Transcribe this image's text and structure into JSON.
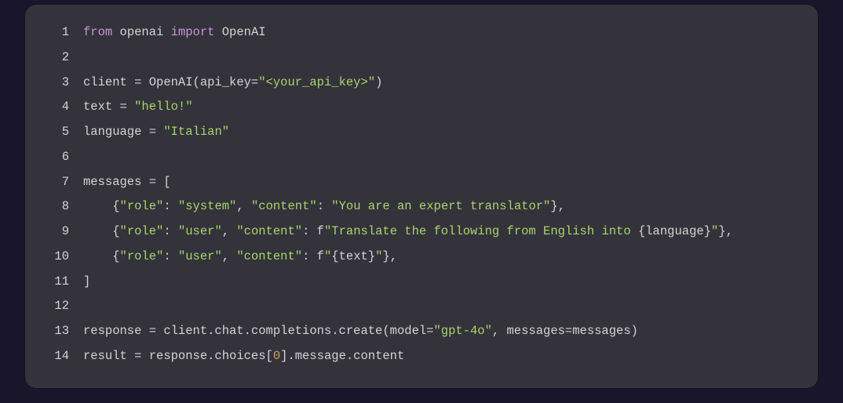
{
  "code": {
    "lines": [
      {
        "n": "1",
        "tokens": [
          {
            "cls": "kw",
            "t": "from"
          },
          {
            "cls": "id",
            "t": " openai "
          },
          {
            "cls": "kw",
            "t": "import"
          },
          {
            "cls": "id",
            "t": " OpenAI"
          }
        ]
      },
      {
        "n": "2",
        "tokens": [
          {
            "cls": "id",
            "t": ""
          }
        ]
      },
      {
        "n": "3",
        "tokens": [
          {
            "cls": "id",
            "t": "client = OpenAI(api_key="
          },
          {
            "cls": "str",
            "t": "\"<your_api_key>\""
          },
          {
            "cls": "id",
            "t": ")"
          }
        ]
      },
      {
        "n": "4",
        "tokens": [
          {
            "cls": "id",
            "t": "text = "
          },
          {
            "cls": "str",
            "t": "\"hello!\""
          }
        ]
      },
      {
        "n": "5",
        "tokens": [
          {
            "cls": "id",
            "t": "language = "
          },
          {
            "cls": "str",
            "t": "\"Italian\""
          }
        ]
      },
      {
        "n": "6",
        "tokens": [
          {
            "cls": "id",
            "t": ""
          }
        ]
      },
      {
        "n": "7",
        "tokens": [
          {
            "cls": "id",
            "t": "messages = ["
          }
        ]
      },
      {
        "n": "8",
        "tokens": [
          {
            "cls": "id",
            "t": "    {"
          },
          {
            "cls": "str",
            "t": "\"role\""
          },
          {
            "cls": "id",
            "t": ": "
          },
          {
            "cls": "str",
            "t": "\"system\""
          },
          {
            "cls": "id",
            "t": ", "
          },
          {
            "cls": "str",
            "t": "\"content\""
          },
          {
            "cls": "id",
            "t": ": "
          },
          {
            "cls": "str",
            "t": "\"You are an expert translator\""
          },
          {
            "cls": "id",
            "t": "},"
          }
        ]
      },
      {
        "n": "9",
        "tokens": [
          {
            "cls": "id",
            "t": "    {"
          },
          {
            "cls": "str",
            "t": "\"role\""
          },
          {
            "cls": "id",
            "t": ": "
          },
          {
            "cls": "str",
            "t": "\"user\""
          },
          {
            "cls": "id",
            "t": ", "
          },
          {
            "cls": "str",
            "t": "\"content\""
          },
          {
            "cls": "id",
            "t": ": f"
          },
          {
            "cls": "str",
            "t": "\"Translate the following from English into "
          },
          {
            "cls": "id",
            "t": "{language}"
          },
          {
            "cls": "str",
            "t": "\""
          },
          {
            "cls": "id",
            "t": "},"
          }
        ]
      },
      {
        "n": "10",
        "tokens": [
          {
            "cls": "id",
            "t": "    {"
          },
          {
            "cls": "str",
            "t": "\"role\""
          },
          {
            "cls": "id",
            "t": ": "
          },
          {
            "cls": "str",
            "t": "\"user\""
          },
          {
            "cls": "id",
            "t": ", "
          },
          {
            "cls": "str",
            "t": "\"content\""
          },
          {
            "cls": "id",
            "t": ": f"
          },
          {
            "cls": "str",
            "t": "\""
          },
          {
            "cls": "id",
            "t": "{text}"
          },
          {
            "cls": "str",
            "t": "\""
          },
          {
            "cls": "id",
            "t": "},"
          }
        ]
      },
      {
        "n": "11",
        "tokens": [
          {
            "cls": "id",
            "t": "]"
          }
        ]
      },
      {
        "n": "12",
        "tokens": [
          {
            "cls": "id",
            "t": ""
          }
        ]
      },
      {
        "n": "13",
        "tokens": [
          {
            "cls": "id",
            "t": "response = client.chat.completions.create(model="
          },
          {
            "cls": "str",
            "t": "\"gpt-4o\""
          },
          {
            "cls": "id",
            "t": ", messages=messages)"
          }
        ]
      },
      {
        "n": "14",
        "tokens": [
          {
            "cls": "id",
            "t": "result = response.choices["
          },
          {
            "cls": "num",
            "t": "0"
          },
          {
            "cls": "id",
            "t": "].message.content"
          }
        ]
      }
    ]
  }
}
